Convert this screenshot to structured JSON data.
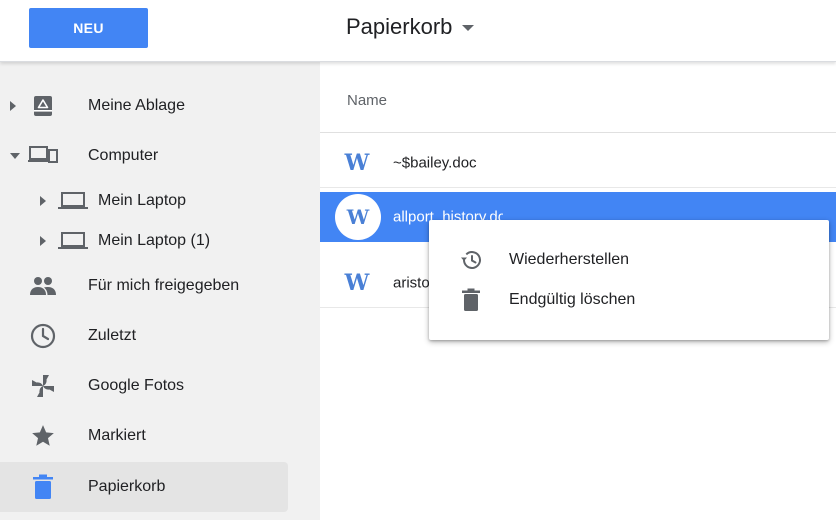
{
  "header": {
    "new_button": "NEU",
    "title": "Papierkorb"
  },
  "sidebar": {
    "items": [
      {
        "label": "Meine Ablage",
        "icon": "drive-icon"
      },
      {
        "label": "Computer",
        "icon": "computer-icon"
      },
      {
        "label": "Mein Laptop",
        "icon": "laptop-icon"
      },
      {
        "label": "Mein Laptop (1)",
        "icon": "laptop-icon"
      },
      {
        "label": "Für mich freigegeben",
        "icon": "people-icon"
      },
      {
        "label": "Zuletzt",
        "icon": "clock-icon"
      },
      {
        "label": "Google Fotos",
        "icon": "photos-icon"
      },
      {
        "label": "Markiert",
        "icon": "star-icon"
      },
      {
        "label": "Papierkorb",
        "icon": "trash-icon"
      }
    ],
    "active": "Papierkorb"
  },
  "main": {
    "column_header": "Name",
    "files": [
      {
        "name": "~$bailey.doc",
        "icon": "word-doc-icon"
      },
      {
        "name": "allport_history.doc",
        "icon": "word-doc-icon",
        "selected": true
      },
      {
        "name": "aristotle.doc",
        "icon": "word-doc-icon"
      }
    ]
  },
  "context_menu": {
    "items": [
      {
        "label": "Wiederherstellen",
        "icon": "restore-history-icon"
      },
      {
        "label": "Endgültig löschen",
        "icon": "trash-icon"
      }
    ]
  },
  "colors": {
    "accent": "#4285f4",
    "sidebar_bg": "#f1f1f1",
    "active_bg": "#e4e4e4",
    "icon_gray": "#5f6368",
    "word_blue": "#4a80d6"
  }
}
